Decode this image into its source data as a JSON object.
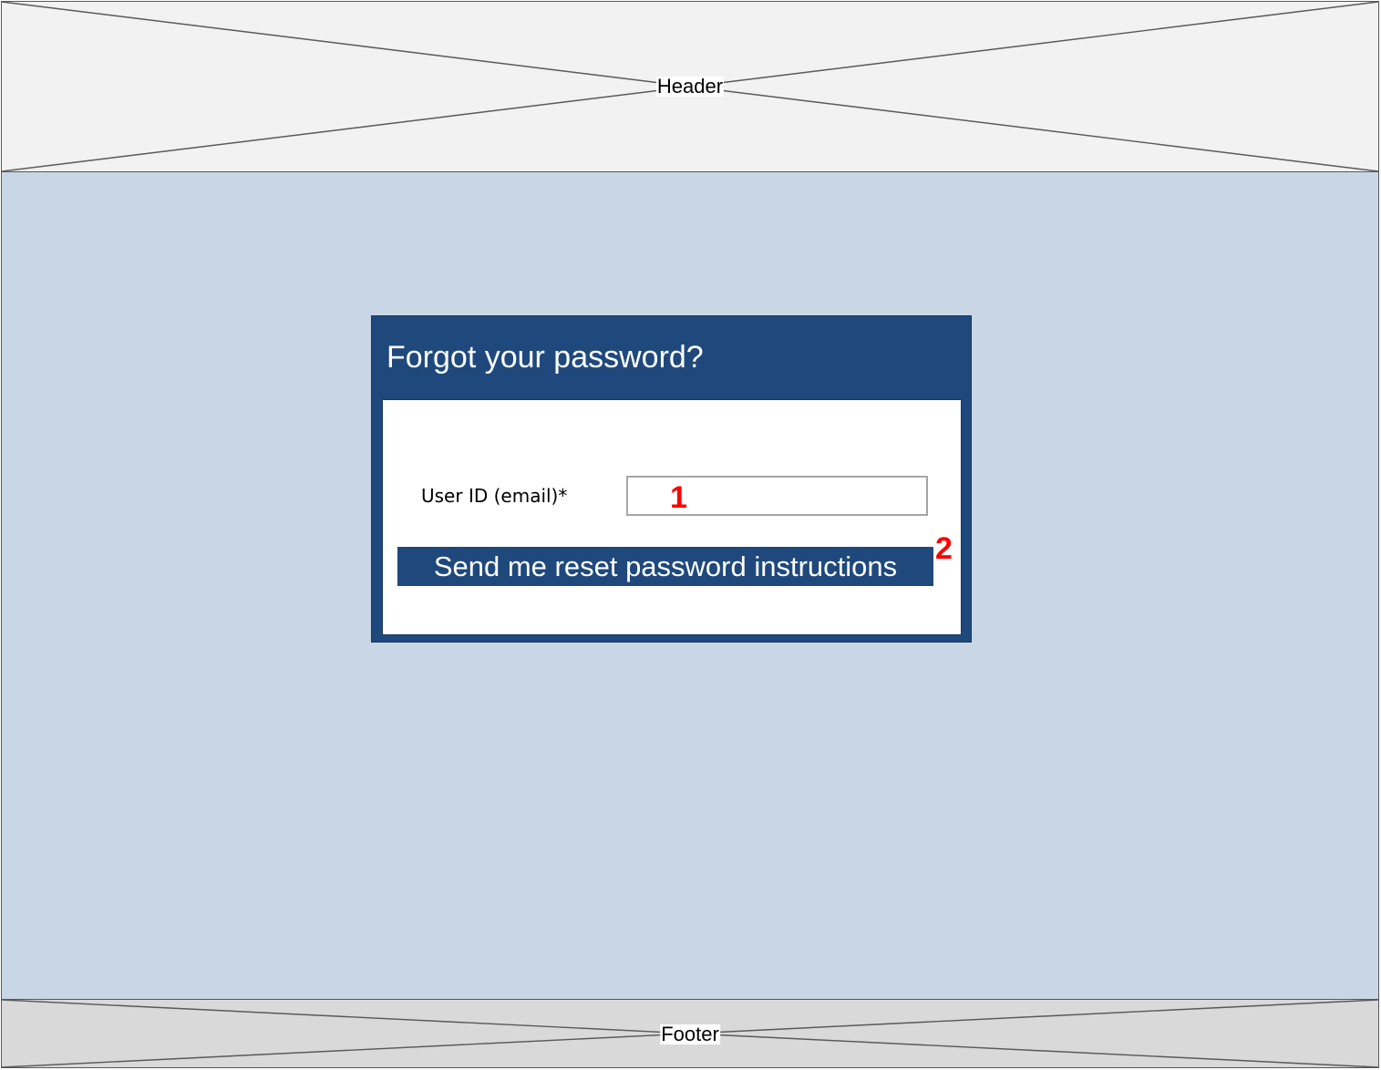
{
  "header": {
    "label": "Header"
  },
  "dialog": {
    "title": "Forgot your password?",
    "field": {
      "label": "User ID (email)*",
      "value": ""
    },
    "send_button_label": "Send me reset password instructions",
    "annotations": {
      "field_marker": "1",
      "button_marker": "2"
    }
  },
  "footer": {
    "label": "Footer"
  },
  "colors": {
    "dialog_blue": "#1f497d",
    "page_background": "#c9d6e6",
    "header_background": "#f2f2f2",
    "footer_background": "#d9d9d9",
    "annotation_red": "#ff0000"
  }
}
